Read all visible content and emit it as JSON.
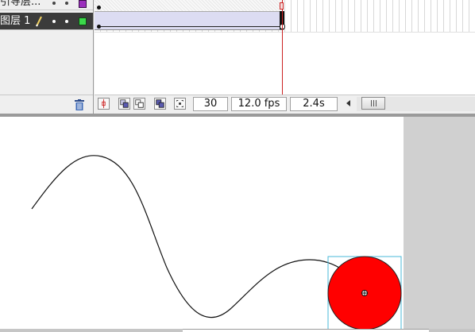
{
  "layers": [
    {
      "name": "引导层...",
      "color": "#9b2fbd",
      "selected": false
    },
    {
      "name": "图层 1",
      "color": "#3bd84a",
      "selected": true
    }
  ],
  "timeline_status": {
    "current_frame": "30",
    "frame_rate": "12.0 fps",
    "elapsed_time": "2.4s"
  },
  "icons": {
    "trash": "trash-icon",
    "pencil": "pencil-icon",
    "center_frame": "center-frame-icon",
    "onion_skin": "onion-skin-icon",
    "onion_skin_outlines": "onion-skin-outlines-icon",
    "edit_multiple_frames": "edit-multiple-frames-icon",
    "modify_onion_markers": "modify-onion-markers-icon",
    "scroll_left": "scroll-left-icon",
    "transform_point": "transform-point-icon"
  },
  "colors": {
    "tween_fill": "#dcdcf2",
    "playhead": "#cc2222",
    "ball": "#ff0000",
    "selection_box": "#4ab8d8",
    "stage_background": "#ffffff",
    "pasteboard": "#d0d0d0"
  }
}
